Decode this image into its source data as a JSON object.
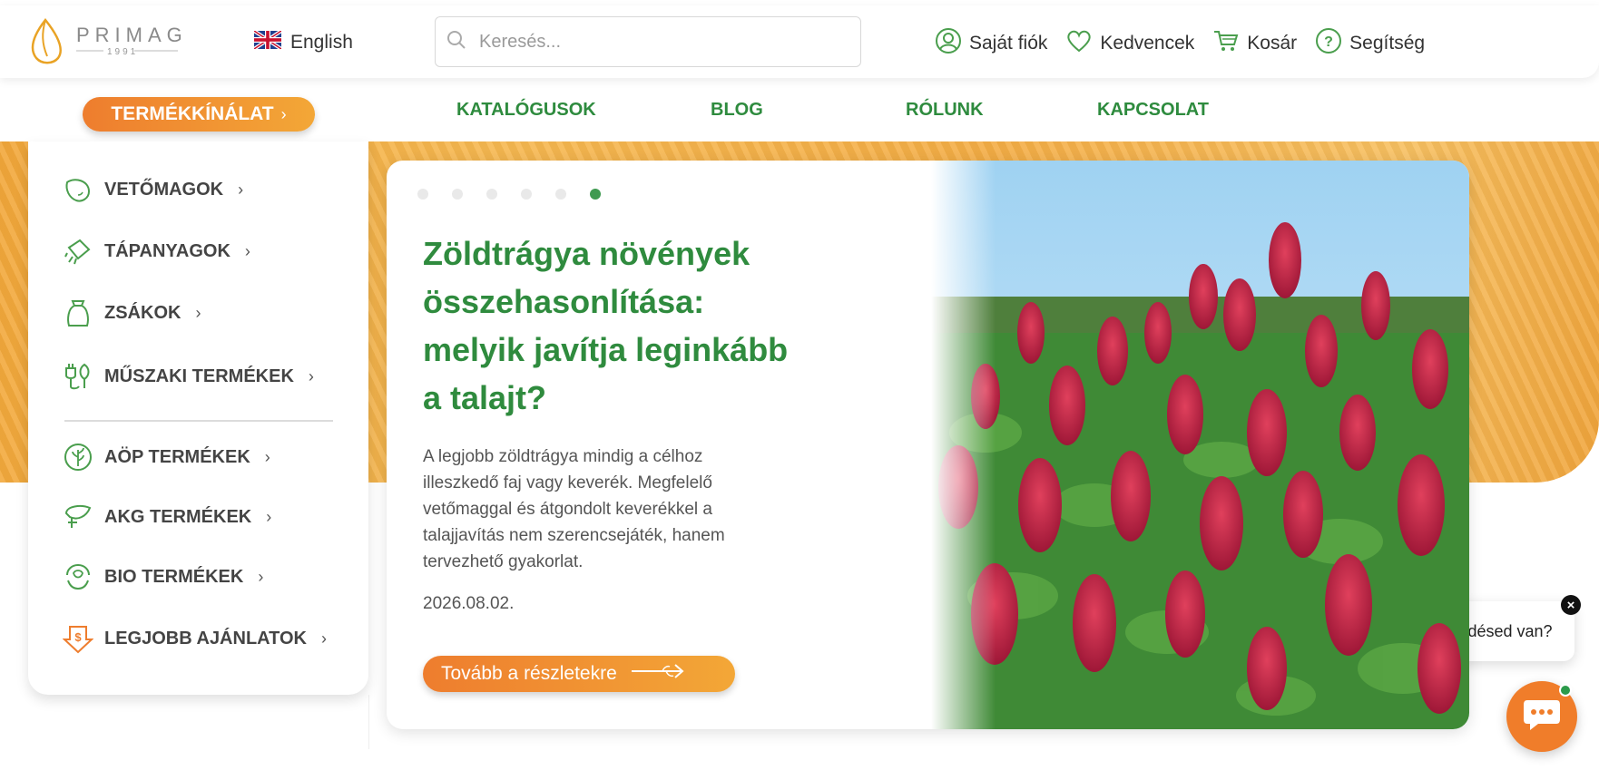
{
  "brand": {
    "name": "PRIMAG",
    "year": "1991"
  },
  "header": {
    "language": "English",
    "search_placeholder": "Keresés...",
    "links": [
      {
        "label": "Saját fiók",
        "icon": "user-icon"
      },
      {
        "label": "Kedvencek",
        "icon": "heart-icon"
      },
      {
        "label": "Kosár",
        "icon": "cart-icon"
      },
      {
        "label": "Segítség",
        "icon": "help-icon"
      }
    ]
  },
  "nav": {
    "products": "TERMÉKKÍNÁLAT",
    "links": [
      "KATALÓGUSOK",
      "BLOG",
      "RÓLUNK",
      "KAPCSOLAT"
    ]
  },
  "sidebar": {
    "items": [
      {
        "label": "VETŐMAGOK",
        "icon": "seed-icon"
      },
      {
        "label": "TÁPANYAGOK",
        "icon": "fertilizer-icon"
      },
      {
        "label": "ZSÁKOK",
        "icon": "sack-icon"
      },
      {
        "label": "MŰSZAKI TERMÉKEK",
        "icon": "technical-icon"
      },
      {
        "label": "AÖP TERMÉKEK",
        "icon": "aop-icon"
      },
      {
        "label": "AKG TERMÉKEK",
        "icon": "akg-icon"
      },
      {
        "label": "BIO TERMÉKEK",
        "icon": "bio-icon"
      },
      {
        "label": "LEGJOBB AJÁNLATOK",
        "icon": "deal-icon"
      }
    ]
  },
  "slider": {
    "slide_count": 6,
    "active_slide": 6,
    "title": "Zöldtrágya növények összehasonlítása: melyik javítja leginkább a talajt?",
    "text": "A legjobb zöldtrágya mindig a célhoz illeszkedő faj vagy keverék. Megfelelő vetőmaggal és átgondolt keverékkel a talajjavítás nem szerencsejáték, hanem tervezhető gyakorlat.",
    "date": "2026.08.02.",
    "button": "Tovább a részletekre"
  },
  "chat": {
    "prompt": "Kérdésed van?",
    "close": "×"
  },
  "colors": {
    "green": "#2f8b3e",
    "orange": "#ee7d2e",
    "amber": "#f3a737"
  }
}
